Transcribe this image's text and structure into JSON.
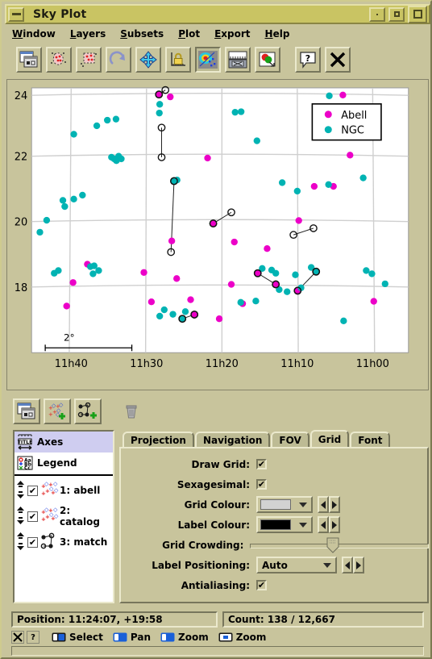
{
  "window": {
    "title": "Sky Plot",
    "buttons": [
      "minimize-button",
      "restore-button",
      "maximize-button"
    ]
  },
  "menubar": {
    "items": [
      {
        "label": "Window",
        "mnemonic": "W"
      },
      {
        "label": "Layers",
        "mnemonic": "L"
      },
      {
        "label": "Subsets",
        "mnemonic": "S"
      },
      {
        "label": "Plot",
        "mnemonic": "P"
      },
      {
        "label": "Export",
        "mnemonic": "E"
      },
      {
        "label": "Help",
        "mnemonic": "H"
      }
    ]
  },
  "toolbar": {
    "buttons": [
      {
        "name": "split-window-icon",
        "title": "Split Window"
      },
      {
        "name": "blob-subset-icon",
        "title": "Draw Blob Subset"
      },
      {
        "name": "rectangle-subset-icon",
        "title": "Draw Rectangle Subset"
      },
      {
        "name": "resize-redraw-icon",
        "title": "Rescale"
      },
      {
        "name": "pan-move-icon",
        "title": "Pan"
      },
      {
        "name": "axis-lock-icon",
        "title": "Lock Axes"
      },
      {
        "name": "density-shader-icon",
        "title": "Sketch Mode"
      },
      {
        "name": "axis-ruler-icon",
        "title": "Show Axes"
      },
      {
        "name": "export-image-icon",
        "title": "Export Image"
      },
      {
        "name": "help-icon",
        "title": "Help"
      },
      {
        "name": "close-icon",
        "title": "Close"
      }
    ]
  },
  "plot": {
    "legend": {
      "entries": [
        {
          "label": "Abell",
          "color": "#ec00c8"
        },
        {
          "label": "NGC",
          "color": "#00b3b3"
        }
      ]
    },
    "scalebar": {
      "label": "2°"
    }
  },
  "chart_data": {
    "type": "scatter",
    "title": "Sky Plot",
    "xlabel": "",
    "ylabel": "",
    "xticks": [
      "11h40",
      "11h30",
      "11h20",
      "11h10",
      "11h00"
    ],
    "xtick_positions": [
      0.105,
      0.305,
      0.505,
      0.705,
      0.905
    ],
    "yticks": [
      "24",
      "22",
      "20",
      "18"
    ],
    "ytick_positions": [
      0.028,
      0.258,
      0.505,
      0.752
    ],
    "grid": true,
    "legend_position": "top-right",
    "series": [
      {
        "name": "Abell",
        "color": "#ec00c8",
        "points": [
          [
            0.338,
            0.025
          ],
          [
            0.368,
            0.034
          ],
          [
            0.826,
            0.027
          ],
          [
            0.467,
            0.265
          ],
          [
            0.845,
            0.254
          ],
          [
            0.75,
            0.372
          ],
          [
            0.801,
            0.372
          ],
          [
            0.482,
            0.512
          ],
          [
            0.709,
            0.501
          ],
          [
            0.538,
            0.582
          ],
          [
            0.372,
            0.578
          ],
          [
            0.625,
            0.607
          ],
          [
            0.148,
            0.666
          ],
          [
            0.11,
            0.735
          ],
          [
            0.298,
            0.697
          ],
          [
            0.385,
            0.72
          ],
          [
            0.53,
            0.742
          ],
          [
            0.6,
            0.7
          ],
          [
            0.648,
            0.742
          ],
          [
            0.706,
            0.766
          ],
          [
            0.318,
            0.808
          ],
          [
            0.422,
            0.8
          ],
          [
            0.56,
            0.815
          ],
          [
            0.908,
            0.806
          ],
          [
            0.093,
            0.824
          ],
          [
            0.432,
            0.856
          ],
          [
            0.498,
            0.872
          ]
        ]
      },
      {
        "name": "NGC",
        "color": "#00b3b3",
        "points": [
          [
            0.79,
            0.03
          ],
          [
            0.34,
            0.062
          ],
          [
            0.201,
            0.122
          ],
          [
            0.224,
            0.118
          ],
          [
            0.173,
            0.143
          ],
          [
            0.112,
            0.175
          ],
          [
            0.339,
            0.095
          ],
          [
            0.54,
            0.092
          ],
          [
            0.556,
            0.09
          ],
          [
            0.598,
            0.2
          ],
          [
            0.212,
            0.262
          ],
          [
            0.219,
            0.268
          ],
          [
            0.231,
            0.258
          ],
          [
            0.225,
            0.275
          ],
          [
            0.238,
            0.268
          ],
          [
            0.88,
            0.34
          ],
          [
            0.083,
            0.425
          ],
          [
            0.112,
            0.42
          ],
          [
            0.135,
            0.405
          ],
          [
            0.088,
            0.448
          ],
          [
            0.378,
            0.352
          ],
          [
            0.386,
            0.348
          ],
          [
            0.665,
            0.358
          ],
          [
            0.705,
            0.39
          ],
          [
            0.788,
            0.365
          ],
          [
            0.04,
            0.5
          ],
          [
            0.022,
            0.545
          ],
          [
            0.156,
            0.675
          ],
          [
            0.166,
            0.672
          ],
          [
            0.071,
            0.69
          ],
          [
            0.06,
            0.7
          ],
          [
            0.163,
            0.702
          ],
          [
            0.178,
            0.69
          ],
          [
            0.612,
            0.682
          ],
          [
            0.637,
            0.688
          ],
          [
            0.648,
            0.7
          ],
          [
            0.7,
            0.706
          ],
          [
            0.742,
            0.678
          ],
          [
            0.755,
            0.694
          ],
          [
            0.888,
            0.69
          ],
          [
            0.903,
            0.702
          ],
          [
            0.657,
            0.762
          ],
          [
            0.678,
            0.77
          ],
          [
            0.715,
            0.755
          ],
          [
            0.938,
            0.74
          ],
          [
            0.352,
            0.838
          ],
          [
            0.375,
            0.855
          ],
          [
            0.408,
            0.845
          ],
          [
            0.34,
            0.862
          ],
          [
            0.4,
            0.872
          ],
          [
            0.828,
            0.88
          ],
          [
            0.555,
            0.81
          ],
          [
            0.595,
            0.805
          ]
        ]
      }
    ],
    "match_links": [
      [
        [
          0.338,
          0.025
        ],
        [
          0.355,
          0.008
        ]
      ],
      [
        [
          0.345,
          0.15
        ],
        [
          0.345,
          0.262
        ]
      ],
      [
        [
          0.482,
          0.512
        ],
        [
          0.53,
          0.47
        ]
      ],
      [
        [
          0.695,
          0.555
        ],
        [
          0.748,
          0.53
        ]
      ],
      [
        [
          0.37,
          0.62
        ],
        [
          0.378,
          0.352
        ]
      ],
      [
        [
          0.6,
          0.7
        ],
        [
          0.648,
          0.742
        ]
      ],
      [
        [
          0.706,
          0.766
        ],
        [
          0.755,
          0.694
        ]
      ],
      [
        [
          0.432,
          0.856
        ],
        [
          0.4,
          0.872
        ]
      ]
    ]
  },
  "layerbar": {
    "buttons": [
      {
        "name": "add-axes-control-icon"
      },
      {
        "name": "add-scatter-layer-icon"
      },
      {
        "name": "add-link-layer-icon"
      },
      {
        "name": "delete-layer-icon"
      }
    ]
  },
  "tree": {
    "fixed": [
      {
        "label": "Axes",
        "icon": "axes-icon",
        "selected": true
      },
      {
        "label": "Legend",
        "icon": "legend-icon",
        "selected": false
      }
    ],
    "layers": [
      {
        "index": "1",
        "label": "1: abell",
        "icon": "scatter-icon",
        "checked": true
      },
      {
        "index": "2",
        "label": "2: catalog",
        "icon": "scatter-icon",
        "checked": true
      },
      {
        "index": "3",
        "label": "3: match",
        "icon": "link-icon",
        "checked": true
      }
    ]
  },
  "tabs": {
    "items": [
      "Projection",
      "Navigation",
      "FOV",
      "Grid",
      "Font"
    ],
    "active": "Grid"
  },
  "grid_form": {
    "draw_grid": {
      "label": "Draw Grid:",
      "checked": true
    },
    "sexagesimal": {
      "label": "Sexagesimal:",
      "checked": true
    },
    "grid_colour": {
      "label": "Grid Colour:",
      "value": "#d2d2d2"
    },
    "label_colour": {
      "label": "Label Colour:",
      "value": "#000000"
    },
    "grid_crowding": {
      "label": "Grid Crowding:",
      "value": 46
    },
    "label_positioning": {
      "label": "Label Positioning:",
      "value": "Auto"
    },
    "antialiasing": {
      "label": "Antialiasing:",
      "checked": true
    }
  },
  "status": {
    "position": "Position: 11:24:07, +19:58",
    "count": "Count: 138 / 12,667"
  },
  "navbar": {
    "close_label": "✕",
    "help_label": "?",
    "actions": [
      {
        "label": "Select",
        "icon": "mouse-left-icon"
      },
      {
        "label": "Pan",
        "icon": "mouse-left-drag-icon"
      },
      {
        "label": "Zoom",
        "icon": "mouse-right-icon"
      },
      {
        "label": "Zoom",
        "icon": "mouse-wheel-icon"
      }
    ]
  }
}
